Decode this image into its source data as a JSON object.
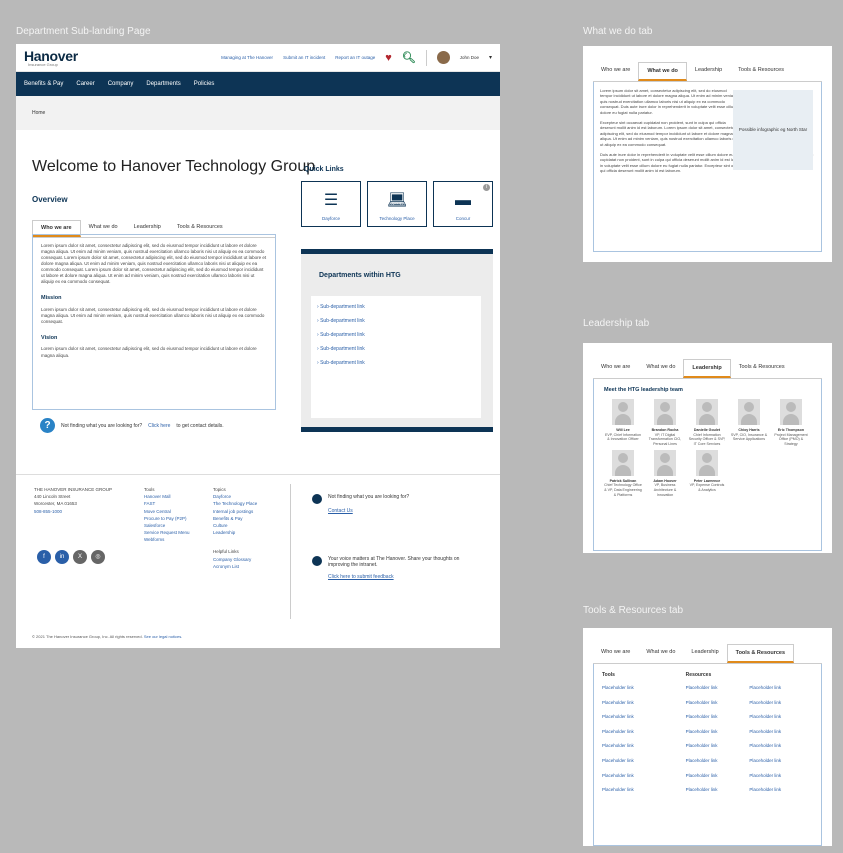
{
  "canvas": {
    "main_label": "Department Sub-landing Page",
    "whatwedo_label": "What we do tab",
    "leadership_label": "Leadership tab",
    "tools_label": "Tools & Resources tab"
  },
  "header": {
    "logo": "Hanover",
    "logo_sub": "Insurance Group",
    "links": [
      "Managing at The Hanover",
      "Submit an IT incident",
      "Report an IT outage"
    ],
    "user": "John Doe"
  },
  "nav": [
    "Benefits & Pay",
    "Career",
    "Company",
    "Departments",
    "Policies"
  ],
  "breadcrumb": "Home",
  "welcome": "Welcome to Hanover Technology Group",
  "overview": "Overview",
  "tabs": [
    "Who we are",
    "What we do",
    "Leadership",
    "Tools & Resources"
  ],
  "who_we_are": {
    "intro": "Lorem ipsum dolor sit amet, consectetur adipiscing elit, sed do eiusmod tempor incididunt ut labore et dolore magna aliqua. Ut enim ad minim veniam, quis nostrud exercitation ullamco laboris nisi ut aliquip ex ea commodo consequat. Lorem ipsum dolor sit amet, consectetur adipiscing elit, sed do eiusmod tempor incididunt ut labore et dolore magna aliqua. Ut enim ad minim veniam, quis nostrud exercitation ullamco laboris nisi ut aliquip ex ea commodo consequat. Lorem ipsum dolor sit amet, consectetur adipiscing elit, sed do eiusmod tempor incididunt ut labore et dolore magna aliqua. Ut enim ad minim veniam, quis nostrud exercitation ullamco laboris nisi ut aliquip ex ea commodo consequat.",
    "mission_h": "Mission",
    "mission": "Lorem ipsum dolor sit amet, consectetur adipiscing elit, sed do eiusmod tempor incididunt ut labore et dolore magna aliqua. Ut enim ad minim veniam, quis nostrud exercitation ullamco laboris nisi ut aliquip ex ea commodo consequat.",
    "vision_h": "Vision",
    "vision": "Lorem ipsum dolor sit amet, consectetur adipiscing elit, sed do eiusmod tempor incididunt ut labore et dolore magna aliqua."
  },
  "help": {
    "text": "Not finding what you are looking for?",
    "link": "Click here",
    "suffix": "to get contact details."
  },
  "quick_links": {
    "title": "Quick Links",
    "items": [
      {
        "label": "Dayforce",
        "icon": "list-icon"
      },
      {
        "label": "Technology Place",
        "icon": "laptop-icon"
      },
      {
        "label": "Concur",
        "icon": "card-icon"
      }
    ]
  },
  "departments": {
    "title": "Departments within HTG",
    "items": [
      "Sub-department link",
      "Sub-department link",
      "Sub-department link",
      "Sub-department link",
      "Sub-department link"
    ]
  },
  "footer": {
    "company": "THE HANOVER INSURANCE GROUP",
    "address1": "440 Lincoln Street",
    "address2": "Worcester, MA 01653",
    "phone": "508-855-1000",
    "tools_h": "Tools",
    "tools": [
      "Hanover Mall",
      "FAST",
      "Move Central",
      "Procure to Pay (P2P)",
      "Salesforce",
      "Service Request Menu",
      "Webforms"
    ],
    "topics_h": "Topics",
    "topics": [
      "Dayforce",
      "The Technology Place",
      "Internal job postings",
      "Benefits & Pay",
      "Culture",
      "Leadership"
    ],
    "helpful_h": "Helpful Links",
    "helpful": [
      "Company Glossary",
      "Acronym List"
    ],
    "right1": "Not finding what you are looking for?",
    "right1_link": "Contact Us",
    "right2": "Your voice matters at The Hanover. Share your thoughts on improving the intranet.",
    "right2_link": "Click here to submit feedback",
    "copyright": "© 2021 The Hanover Insurance Group, Inc. All rights reserved.",
    "copyright_link": "See our legal notices."
  },
  "whatwedo": {
    "p1": "Lorem ipsum dolor sit amet, consectetur adipiscing elit, sed do eiusmod tempor incididunt ut labore et dolore magna aliqua. Ut enim ad minim veniam, quis nostrud exercitation ullamco laboris nisi ut aliquip ex ea commodo consequat. Duis aute irure dolor in reprehenderit in voluptate velit esse cillum dolore eu fugiat nulla pariatur.",
    "p2": "Excepteur sint occaecat cupidatat non proident, sunt in culpa qui officia deserunt mollit anim id est laborum. Lorem ipsum dolor sit amet, consectetur adipiscing elit, sed do eiusmod tempor incididunt ut labore et dolore magna aliqua. Ut enim ad minim veniam, quis nostrud exercitation ullamco laboris nisi ut aliquip ex ea commodo consequat.",
    "p3": "Duis aute irure dolor in reprehenderit in voluptate velit esse cillum dolore eu fugiat nulla pariatur. Excepteur sint occaecat cupidatat non proident, sunt in culpa qui officia deserunt mollit anim id est laborum. Duis aute irure dolor in reprehenderit in voluptate velit esse cillum dolore eu fugiat nulla pariatur. Excepteur sint occaecat cupidatat non proident, sunt in culpa qui officia deserunt mollit anim id est laborum.",
    "infographic": "Possible infographic eg North Star"
  },
  "leadership": {
    "title": "Meet the HTG leadership team",
    "people": [
      {
        "name": "Will Lee",
        "role": "EVP, Chief Information & Innovation Officer"
      },
      {
        "name": "Brandon Rocha",
        "role": "VP, IT Digital Transformation CIO, Personal Lines"
      },
      {
        "name": "Danielle Goulet",
        "role": "Chief Information Security Officer & SVP, IT Core Services"
      },
      {
        "name": "Chioy Harris",
        "role": "SVP, CIO, Insurance & Service Applications"
      },
      {
        "name": "Eric Thompson",
        "role": "Project Management Office (PMO) & Strategy"
      },
      {
        "name": "Patrick Sullivan",
        "role": "Chief Technology Office & VP, Data Engineering & Platforms"
      },
      {
        "name": "Adam Hoover",
        "role": "VP, Business Architecture & Innovation"
      },
      {
        "name": "Peter Lawrence",
        "role": "VP, Expense Controls & Analytics"
      }
    ]
  },
  "tools_tab": {
    "tools_h": "Tools",
    "resources_h": "Resources",
    "tools": [
      "Placeholder link",
      "Placeholder link",
      "Placeholder link",
      "Placeholder link",
      "Placeholder link",
      "Placeholder link",
      "Placeholder link",
      "Placeholder link"
    ],
    "resources1": [
      "Placeholder link",
      "Placeholder link",
      "Placeholder link",
      "Placeholder link",
      "Placeholder link",
      "Placeholder link",
      "Placeholder link",
      "Placeholder link"
    ],
    "resources2": [
      "Placeholder link",
      "Placeholder link",
      "Placeholder link",
      "Placeholder link",
      "Placeholder link",
      "Placeholder link",
      "Placeholder link",
      "Placeholder link"
    ]
  }
}
